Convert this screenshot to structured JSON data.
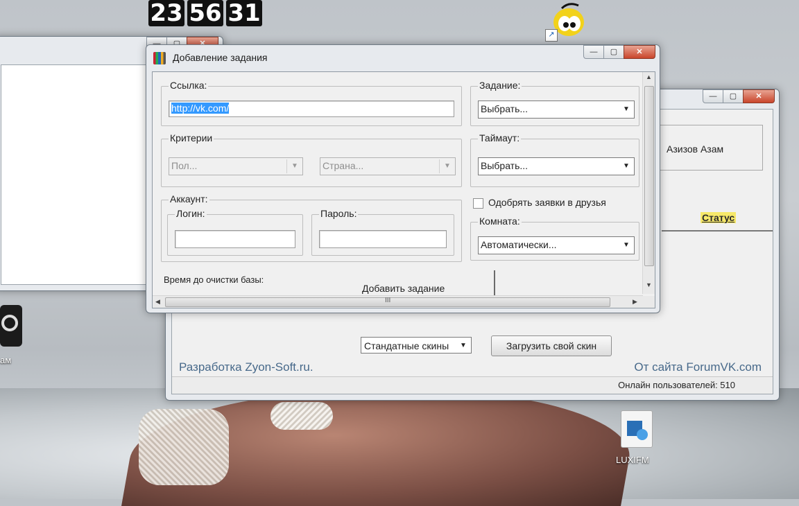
{
  "clock": {
    "digits": [
      "23",
      "56",
      "31"
    ]
  },
  "desktop": {
    "icon_steam_label": "ам",
    "icon_luxi_label": "LUXIFM"
  },
  "left_window": {},
  "right_window": {
    "user_name": "Азизов Азам",
    "status_link": "Статус",
    "skins_select": "Стандатные скины",
    "load_skin_button": "Загрузить свой скин",
    "dev_text": "Разработка Zyon-Soft.ru.",
    "site_text": "От сайта ForumVK.com",
    "online_text": "Онлайн пользователей: 510"
  },
  "dialog": {
    "title": "Добавление задания",
    "link_group": "Ссылка:",
    "link_value": "http://vk.com/",
    "criteria_group": "Критерии",
    "gender_select": "Пол...",
    "country_select": "Страна...",
    "account_group": "Аккаунт:",
    "login_group": "Логин:",
    "password_group": "Пароль:",
    "task_group": "Задание:",
    "task_select": "Выбрать...",
    "timeout_group": "Таймаут:",
    "timeout_select": "Выбрать...",
    "approve_checkbox": "Одобрять заявки в друзья",
    "room_group": "Комната:",
    "room_select": "Автоматически...",
    "cleanup_label": "Время до очистки базы:",
    "add_task_button": "Добавить задание",
    "hscroll_grip": "III"
  },
  "caption_buttons": {
    "minimize": "—",
    "maximize": "▢",
    "close": "✕"
  },
  "colors": {
    "link_text": "#47698a",
    "selection": "#3399ff",
    "status_highlight": "#f6e86a"
  }
}
